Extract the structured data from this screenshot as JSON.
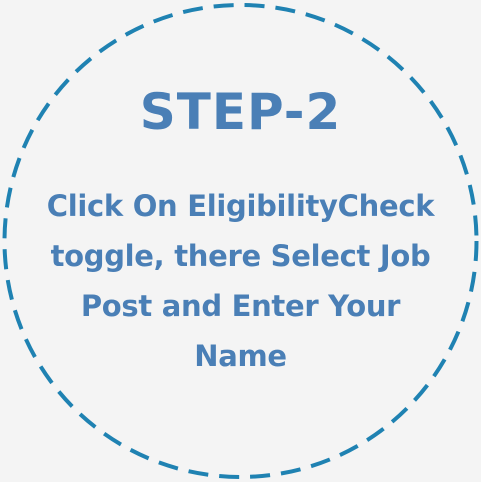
{
  "colors": {
    "background": "#f4f4f4",
    "ring": "#1f82b2",
    "text": "#4a7fb6"
  },
  "step": {
    "title": "STEP-2",
    "lines": [
      "Click On EligibilityCheck",
      "toggle, there Select Job",
      "Post and Enter Your",
      "Name"
    ]
  }
}
